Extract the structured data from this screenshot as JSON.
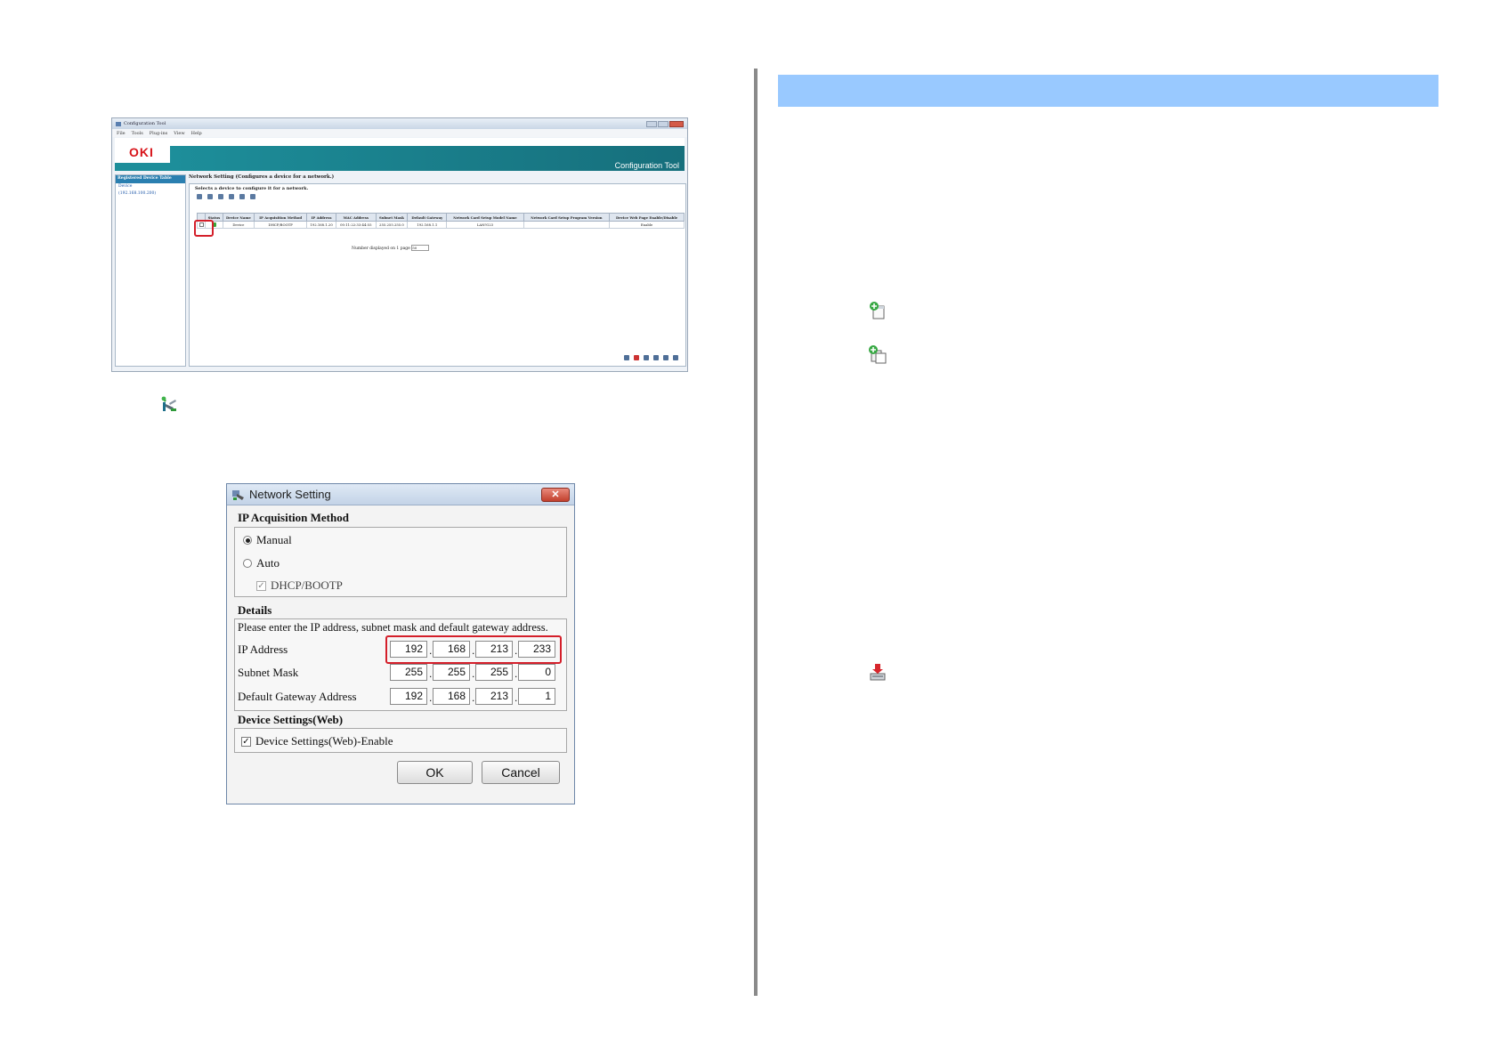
{
  "config_tool": {
    "window_title": "Configuration Tool",
    "menu": [
      "File",
      "Tools",
      "Plug-ins",
      "View",
      "Help"
    ],
    "brand_logo": "OKI",
    "banner_title": "Configuration Tool",
    "sidebar": {
      "heading": "Registered Device Table",
      "items": [
        "Device",
        "(192.168.100.200)"
      ]
    },
    "panel_title": "Network Setting (Configures a device for a network.)",
    "instruction": "Selects a device to configure it for a network.",
    "table": {
      "columns": [
        "",
        "Status",
        "Device Name",
        "IP Acquisition Method",
        "IP Address",
        "MAC Address",
        "Subnet Mask",
        "Default Gateway",
        "Network Card Setup Model Name",
        "Network Card Setup Program Version",
        "Device Web Page Enable/Disable"
      ],
      "rows": [
        [
          "",
          "",
          "Device",
          "DHCP/BOOTP",
          "192.168.1.20",
          "00:11:22:33:44:55",
          "255.255.255.0",
          "192.168.1.1",
          "LAN9123",
          "",
          "Enable"
        ]
      ]
    },
    "pager_label": "Number displayed on 1 page",
    "pager_value": "50"
  },
  "network_dialog": {
    "title": "Network Setting",
    "ip_method_label": "IP Acquisition Method",
    "manual_label": "Manual",
    "auto_label": "Auto",
    "dhcp_label": "DHCP/BOOTP",
    "details_label": "Details",
    "details_note": "Please enter the IP address, subnet mask and default gateway address.",
    "ip_address_label": "IP Address",
    "ip_address": [
      "192",
      "168",
      "213",
      "233"
    ],
    "subnet_mask_label": "Subnet Mask",
    "subnet_mask": [
      "255",
      "255",
      "255",
      "0"
    ],
    "gateway_label": "Default Gateway Address",
    "gateway": [
      "192",
      "168",
      "213",
      "1"
    ],
    "web_group_label": "Device Settings(Web)",
    "web_enable_label": "Device Settings(Web)-Enable",
    "ok_label": "OK",
    "cancel_label": "Cancel",
    "dot": "."
  },
  "colors": {
    "section_band": "#99c9ff",
    "highlight": "#d41f2a",
    "divider": "#8a8a8a"
  }
}
